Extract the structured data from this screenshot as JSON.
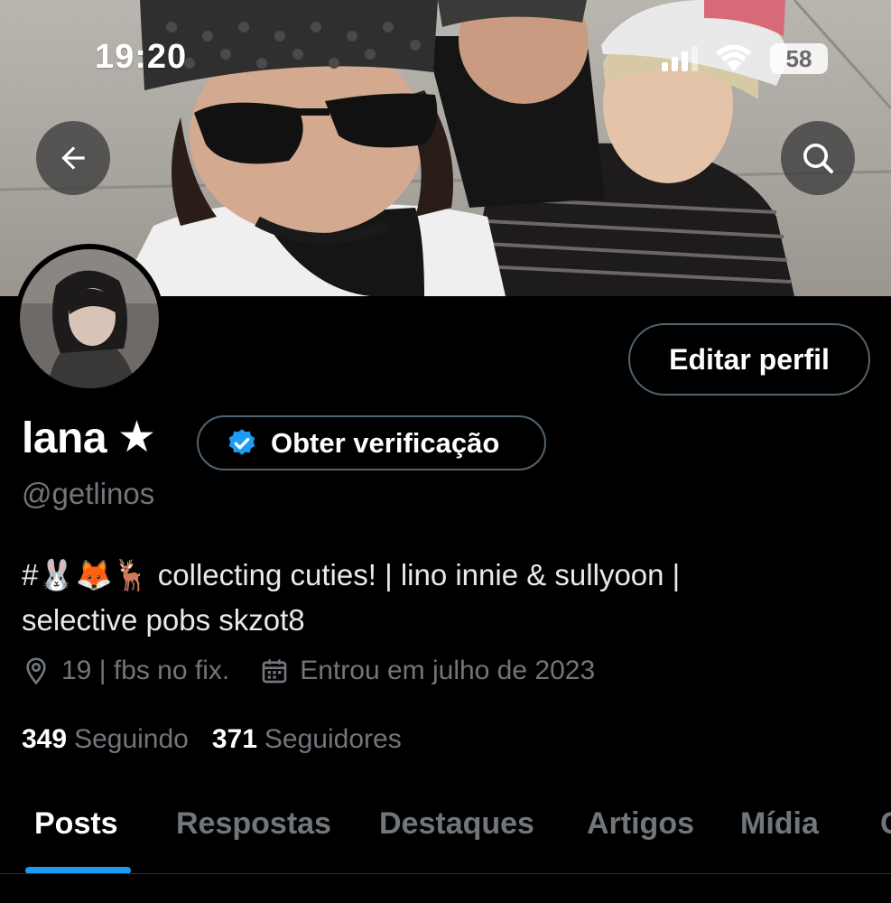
{
  "status_bar": {
    "time": "19:20",
    "battery": "58"
  },
  "banner": {
    "description_icon": "banner-photo"
  },
  "profile": {
    "display_name": "lana",
    "name_symbol": "★",
    "handle": "@getlinos",
    "bio_line1": "#🐰🦊🦌 collecting cuties! | lino innie & sullyoon |",
    "bio_line2": "selective pobs skzot8",
    "location": "19 | fbs no fix.",
    "joined": "Entrou em julho de 2023",
    "following_count": "349",
    "following_label": "Seguindo",
    "followers_count": "371",
    "followers_label": "Seguidores"
  },
  "buttons": {
    "edit_profile": "Editar perfil",
    "get_verified": "Obter verificação"
  },
  "tabs": [
    {
      "label": "Posts",
      "active": true
    },
    {
      "label": "Respostas",
      "active": false
    },
    {
      "label": "Destaques",
      "active": false
    },
    {
      "label": "Artigos",
      "active": false
    },
    {
      "label": "Mídia",
      "active": false
    },
    {
      "label": "C",
      "active": false
    }
  ],
  "colors": {
    "accent": "#1d9bf0",
    "muted": "#71767b",
    "border": "#536471"
  }
}
